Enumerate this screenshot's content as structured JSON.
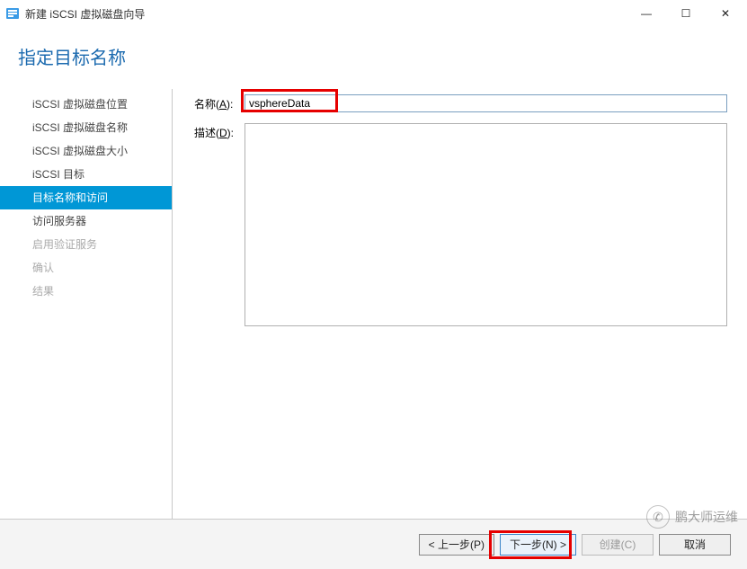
{
  "window": {
    "title": "新建 iSCSI 虚拟磁盘向导",
    "min": "—",
    "max": "☐",
    "close": "✕"
  },
  "heading": "指定目标名称",
  "steps": [
    {
      "label": "iSCSI 虚拟磁盘位置",
      "state": "norm"
    },
    {
      "label": "iSCSI 虚拟磁盘名称",
      "state": "norm"
    },
    {
      "label": "iSCSI 虚拟磁盘大小",
      "state": "norm"
    },
    {
      "label": "iSCSI 目标",
      "state": "norm"
    },
    {
      "label": "目标名称和访问",
      "state": "sel"
    },
    {
      "label": "访问服务器",
      "state": "norm"
    },
    {
      "label": "启用验证服务",
      "state": "dis"
    },
    {
      "label": "确认",
      "state": "dis"
    },
    {
      "label": "结果",
      "state": "dis"
    }
  ],
  "labels": {
    "name_prefix": "名称(",
    "name_key": "A",
    "name_suffix": "):",
    "desc_prefix": "描述(",
    "desc_key": "D",
    "desc_suffix": "):"
  },
  "form": {
    "name_value": "vsphereData",
    "desc_value": ""
  },
  "buttons": {
    "prev": "< 上一步(P)",
    "next": "下一步(N) >",
    "create": "创建(C)",
    "cancel": "取消"
  },
  "watermark": {
    "icon": "✆",
    "text": "鹏大师运维"
  }
}
